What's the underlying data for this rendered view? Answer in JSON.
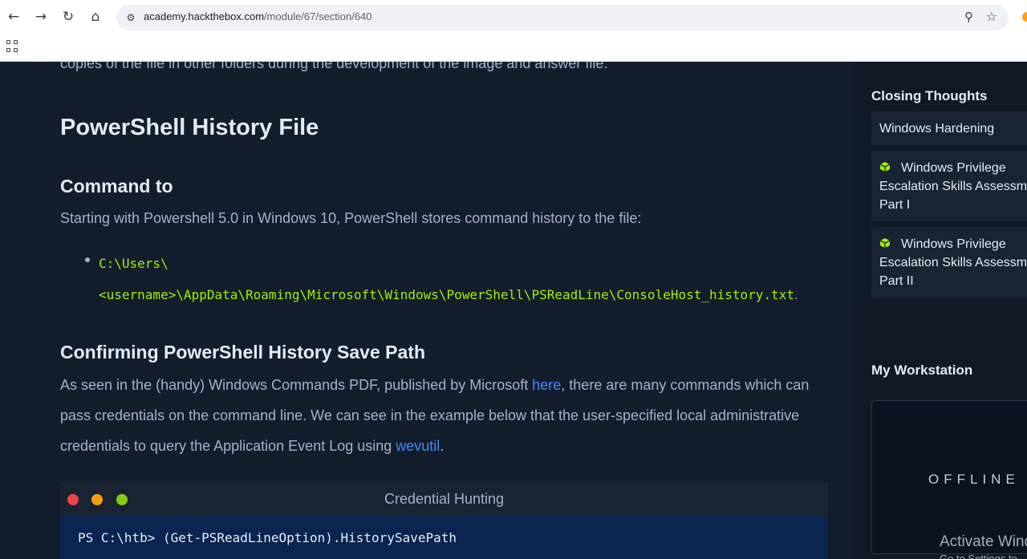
{
  "browser": {
    "url_domain": "academy.hackthebox.com",
    "url_path": "/module/67/section/640"
  },
  "content": {
    "cut_line": "copies of the file in other folders during the development of the image and answer file.",
    "title": "PowerShell History File",
    "subtitle1": "Command to",
    "para1": "Starting with Powershell 5.0 in Windows 10, PowerShell stores command history to the file:",
    "bullet_line1": "C:\\Users\\",
    "bullet_line2": "<username>\\AppData\\Roaming\\Microsoft\\Windows\\PowerShell\\PSReadLine\\ConsoleHost_history.txt",
    "bullet_dot": ".",
    "subtitle2": "Confirming PowerShell History Save Path",
    "para2_a": "As seen in the (handy) Windows Commands PDF, published by Microsoft ",
    "para2_link1": "here",
    "para2_b": ", there are many commands which can pass credentials on the command line. We can see in the example below that the user-specified local administrative credentials to query the Application Event Log using ",
    "para2_link2": "wevutil",
    "para2_c": "."
  },
  "terminal": {
    "title": "Credential Hunting",
    "command": "PS C:\\htb> (Get-PSReadLineOption).HistorySavePath"
  },
  "sidebar": {
    "section_heading": "Closing Thoughts",
    "items": [
      {
        "label": "Windows Hardening"
      },
      {
        "label_l1": "Windows Privilege",
        "label_l2": "Escalation Skills Assessme",
        "label_l3": "Part I"
      },
      {
        "label_l1": "Windows Privilege",
        "label_l2": "Escalation Skills Assessme",
        "label_l3": "Part II"
      }
    ],
    "workstation_heading": "My Workstation",
    "workstation_status": "OFFLINE"
  },
  "overlay": {
    "activate_line1": "Activate Wind",
    "activate_line2": "Go to Settings to"
  },
  "colors": {
    "background": "#141d2b",
    "accent_green": "#9fef00",
    "link_blue": "#3d8bfd"
  }
}
